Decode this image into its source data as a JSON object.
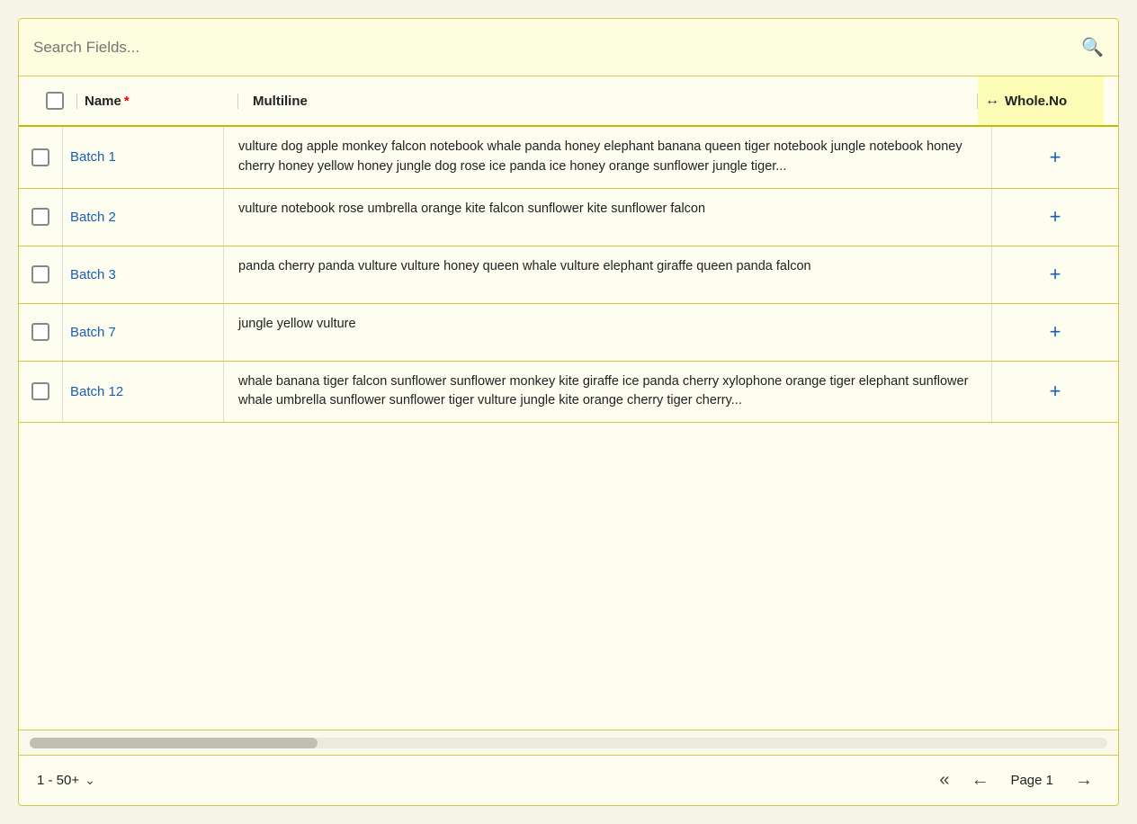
{
  "search": {
    "placeholder": "Search Fields...",
    "icon": "🔍"
  },
  "header": {
    "name_label": "Name",
    "name_required": "*",
    "multiline_label": "Multiline",
    "whole_label": "Whole.No"
  },
  "rows": [
    {
      "name": "Batch 1",
      "multiline": "vulture dog apple monkey falcon notebook whale panda honey elephant banana queen tiger notebook jungle notebook honey cherry honey yellow honey jungle dog rose ice panda ice honey orange sunflower jungle tiger...",
      "add_label": "+"
    },
    {
      "name": "Batch 2",
      "multiline": "vulture notebook rose umbrella orange kite falcon sunflower kite sunflower falcon",
      "add_label": "+"
    },
    {
      "name": "Batch 3",
      "multiline": "panda cherry panda vulture vulture honey queen whale vulture elephant giraffe queen panda falcon",
      "add_label": "+"
    },
    {
      "name": "Batch 7",
      "multiline": "jungle yellow vulture",
      "add_label": "+"
    },
    {
      "name": "Batch 12",
      "multiline": "whale banana tiger falcon sunflower sunflower monkey kite giraffe ice panda cherry xylophone orange tiger elephant sunflower whale umbrella sunflower sunflower tiger vulture jungle kite orange cherry tiger cherry...",
      "add_label": "+"
    }
  ],
  "footer": {
    "count_label": "1 - 50+",
    "page_label": "Page 1",
    "first_btn": "«",
    "prev_btn": "←",
    "next_btn": "→"
  }
}
